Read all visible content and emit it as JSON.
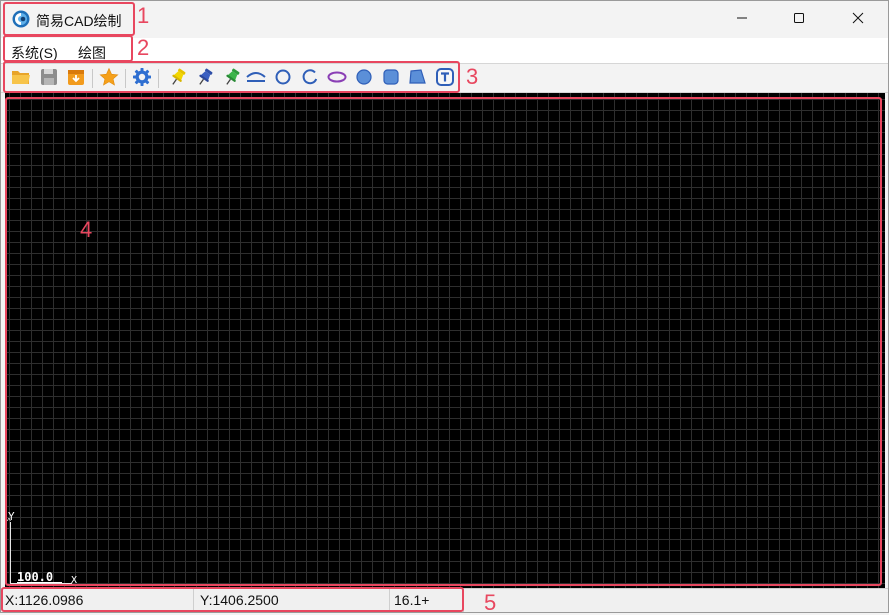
{
  "window": {
    "title": "简易CAD绘制",
    "icons": {
      "app": "app-logo-icon",
      "minimize": "minimize-icon",
      "maximize": "maximize-icon",
      "close": "close-icon"
    }
  },
  "menu": {
    "items": [
      {
        "label": "系统(S)"
      },
      {
        "label": "绘图"
      }
    ]
  },
  "toolbar": {
    "buttons": [
      {
        "icon": "open-folder-icon"
      },
      {
        "icon": "save-disk-icon"
      },
      {
        "icon": "import-icon"
      },
      {
        "icon": "star-icon"
      },
      {
        "icon": "gear-icon"
      },
      {
        "icon": "pin-yellow-icon"
      },
      {
        "icon": "pin-blue-icon"
      },
      {
        "icon": "pin-green-icon"
      },
      {
        "icon": "arc-line-icon"
      },
      {
        "icon": "circle-icon"
      },
      {
        "icon": "partial-arc-icon"
      },
      {
        "icon": "ellipse-icon"
      },
      {
        "icon": "filled-circle-icon"
      },
      {
        "icon": "rounded-rect-icon"
      },
      {
        "icon": "polygon-icon"
      },
      {
        "icon": "text-tool-icon"
      }
    ]
  },
  "canvas": {
    "axis_y_label": "Y",
    "axis_x_label": "X",
    "scale_label": "100.0",
    "background_color": "#000000",
    "grid_color": "#2e2e2e"
  },
  "status": {
    "x": "X:1126.0986",
    "y": "Y:1406.2500",
    "zoom": "16.1+"
  },
  "annotations": [
    "1",
    "2",
    "3",
    "4",
    "5"
  ],
  "colors": {
    "annotation": "#e8475f"
  }
}
